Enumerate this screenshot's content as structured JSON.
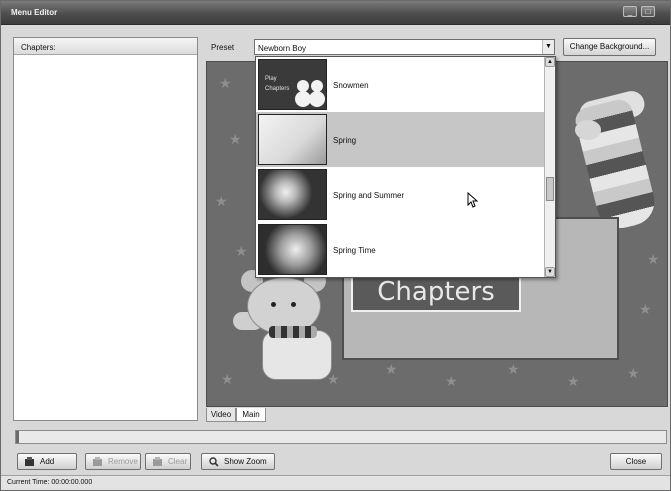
{
  "window": {
    "title": "Menu Editor"
  },
  "left_panel": {
    "header": "Chapters:"
  },
  "preset": {
    "label": "Preset",
    "selected": "Newborn Boy",
    "change_background_label": "Change Background..."
  },
  "dropdown": {
    "items": [
      {
        "label": "Snowmen",
        "thumb_text_1": "Play",
        "thumb_text_2": "Chapters"
      },
      {
        "label": "Spring"
      },
      {
        "label": "Spring and Summer"
      },
      {
        "label": "Spring Time"
      }
    ],
    "selected_index": 1
  },
  "preview": {
    "frame_text": "Chapters"
  },
  "tabs": [
    {
      "label": "Video"
    },
    {
      "label": "Main"
    }
  ],
  "buttons": {
    "add": "Add",
    "remove": "Remove",
    "clear": "Clear",
    "show_zoom": "Show Zoom",
    "close": "Close"
  },
  "status": {
    "current_time": "Current Time: 00:00:00.000"
  },
  "icons": [
    "add-icon",
    "remove-icon",
    "clear-icon",
    "zoom-icon",
    "minimize-icon",
    "close-icon",
    "chevron-down-icon",
    "mouse-cursor-icon"
  ]
}
